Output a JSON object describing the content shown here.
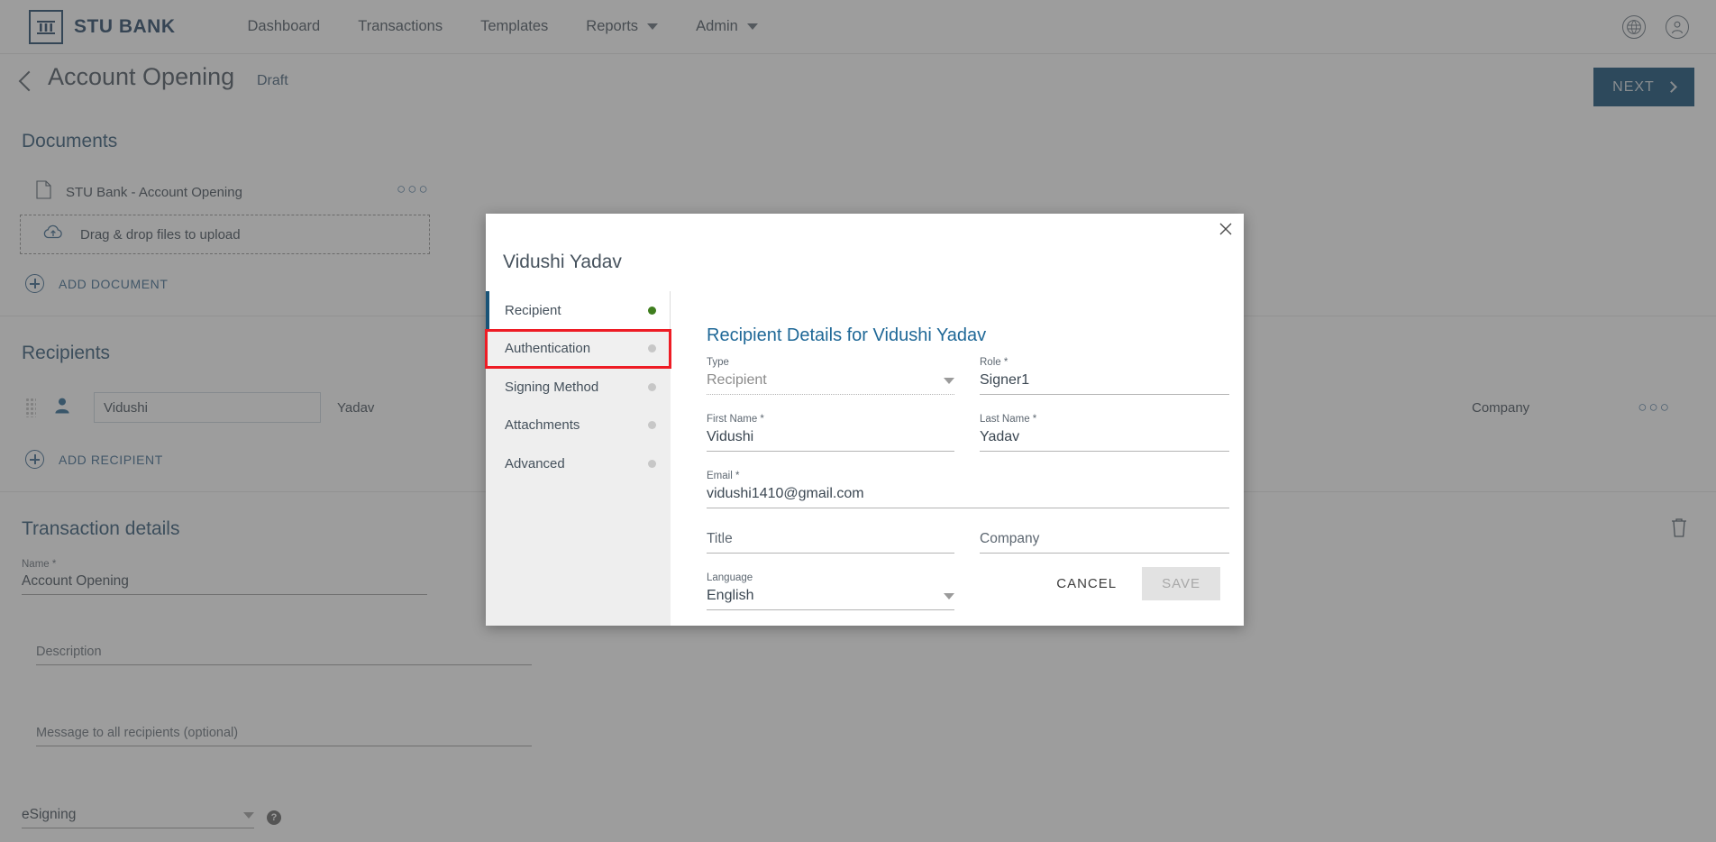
{
  "topnav": {
    "brand": "STU BANK",
    "links": [
      {
        "label": "Dashboard",
        "has_caret": false
      },
      {
        "label": "Transactions",
        "has_caret": false
      },
      {
        "label": "Templates",
        "has_caret": false
      },
      {
        "label": "Reports",
        "has_caret": true
      },
      {
        "label": "Admin",
        "has_caret": true
      }
    ],
    "icons": [
      "globe-icon",
      "user-account-icon"
    ]
  },
  "pagehead": {
    "title": "Account Opening",
    "status": "Draft",
    "next_label": "NEXT"
  },
  "documents": {
    "section_title": "Documents",
    "items": [
      {
        "name": "STU Bank - Account Opening"
      }
    ],
    "dropzone_text": "Drag & drop files to upload",
    "add_label": "ADD DOCUMENT",
    "overflow": "○○○"
  },
  "recipients": {
    "section_title": "Recipients",
    "rows": [
      {
        "first_name": "Vidushi",
        "last_name": "Yadav",
        "company": "Company"
      }
    ],
    "add_label": "ADD RECIPIENT",
    "overflow": "○○○"
  },
  "transaction": {
    "section_title": "Transaction details",
    "name_label": "Name *",
    "name_value": "Account Opening",
    "description_placeholder": "Description",
    "message_placeholder": "Message to all recipients (optional)",
    "type_value": "eSigning"
  },
  "modal": {
    "title": "Vidushi Yadav",
    "close_icon": "close-icon",
    "tabs": [
      {
        "label": "Recipient",
        "state": "active"
      },
      {
        "label": "Authentication",
        "state": "highlighted"
      },
      {
        "label": "Signing Method",
        "state": "default"
      },
      {
        "label": "Attachments",
        "state": "default"
      },
      {
        "label": "Advanced",
        "state": "default"
      }
    ],
    "content_title": "Recipient Details for Vidushi Yadav",
    "fields": {
      "type": {
        "label": "Type",
        "value": "Recipient"
      },
      "role": {
        "label": "Role *",
        "value": "Signer1"
      },
      "first_name": {
        "label": "First Name *",
        "value": "Vidushi"
      },
      "last_name": {
        "label": "Last Name *",
        "value": "Yadav"
      },
      "email": {
        "label": "Email *",
        "value": "vidushi1410@gmail.com"
      },
      "title": {
        "label": "",
        "placeholder": "Title",
        "value": ""
      },
      "company": {
        "label": "",
        "placeholder": "Company",
        "value": ""
      },
      "language": {
        "label": "Language",
        "value": "English"
      }
    },
    "cancel_label": "CANCEL",
    "save_label": "SAVE"
  },
  "colors": {
    "brand_navy": "#15375a",
    "accent_blue": "#00416b",
    "link_blue": "#2f5f86",
    "highlight_red": "#ee1c25",
    "status_green": "#3f7e1e"
  }
}
